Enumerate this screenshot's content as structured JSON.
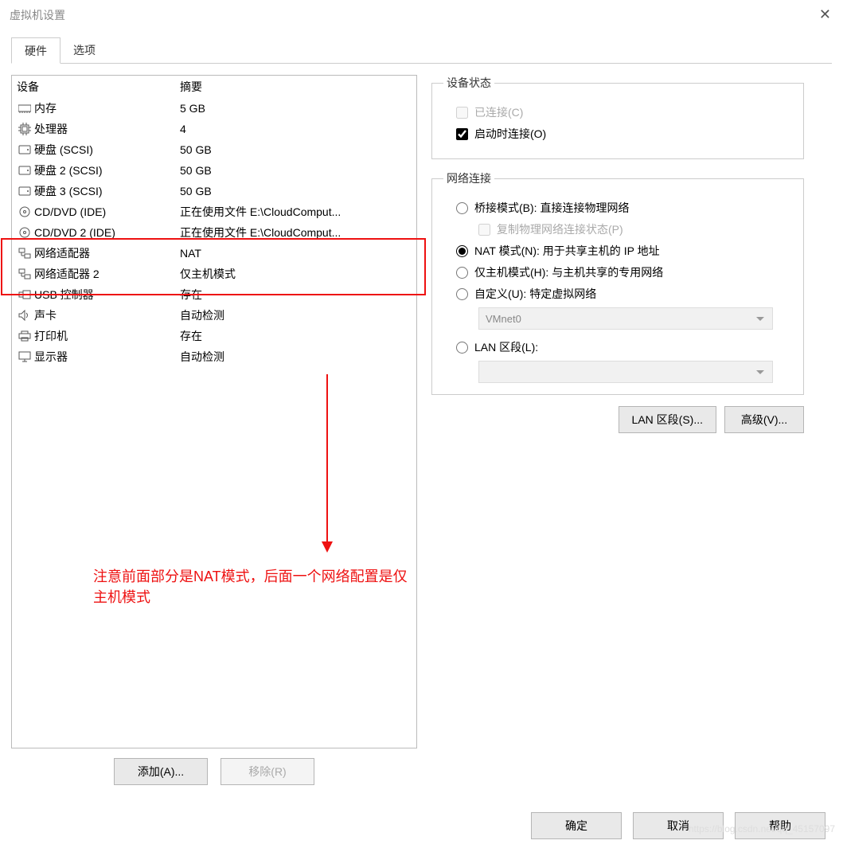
{
  "window": {
    "title": "虚拟机设置"
  },
  "tabs": {
    "hardware": "硬件",
    "options": "选项"
  },
  "list_header": {
    "device": "设备",
    "summary": "摘要"
  },
  "devices": [
    {
      "icon": "memory",
      "name": "内存",
      "summary": "5 GB"
    },
    {
      "icon": "cpu",
      "name": "处理器",
      "summary": "4"
    },
    {
      "icon": "disk",
      "name": "硬盘 (SCSI)",
      "summary": "50 GB"
    },
    {
      "icon": "disk",
      "name": "硬盘 2 (SCSI)",
      "summary": "50 GB"
    },
    {
      "icon": "disk",
      "name": "硬盘 3 (SCSI)",
      "summary": "50 GB"
    },
    {
      "icon": "cd",
      "name": "CD/DVD (IDE)",
      "summary": "正在使用文件 E:\\CloudComput..."
    },
    {
      "icon": "cd",
      "name": "CD/DVD 2 (IDE)",
      "summary": "正在使用文件 E:\\CloudComput..."
    },
    {
      "icon": "net",
      "name": "网络适配器",
      "summary": "NAT"
    },
    {
      "icon": "net",
      "name": "网络适配器 2",
      "summary": "仅主机模式"
    },
    {
      "icon": "usb",
      "name": "USB 控制器",
      "summary": "存在"
    },
    {
      "icon": "sound",
      "name": "声卡",
      "summary": "自动检测"
    },
    {
      "icon": "printer",
      "name": "打印机",
      "summary": "存在"
    },
    {
      "icon": "display",
      "name": "显示器",
      "summary": "自动检测"
    }
  ],
  "bottom_left": {
    "add": "添加(A)...",
    "remove": "移除(R)"
  },
  "right": {
    "status_legend": "设备状态",
    "connected": "已连接(C)",
    "connect_at_start": "启动时连接(O)",
    "net_legend": "网络连接",
    "bridged": "桥接模式(B): 直接连接物理网络",
    "replicate": "复制物理网络连接状态(P)",
    "nat": "NAT 模式(N): 用于共享主机的 IP 地址",
    "hostonly": "仅主机模式(H): 与主机共享的专用网络",
    "custom": "自定义(U): 特定虚拟网络",
    "custom_value": "VMnet0",
    "lanseg": "LAN 区段(L):",
    "lanseg_btn": "LAN 区段(S)...",
    "adv_btn": "高级(V)..."
  },
  "footer": {
    "ok": "确定",
    "cancel": "取消",
    "help": "帮助"
  },
  "annotation": "注意前面部分是NAT模式，后面一个网络配置是仅主机模式",
  "watermark": "https://blog.csdn.net/qq_45157097"
}
